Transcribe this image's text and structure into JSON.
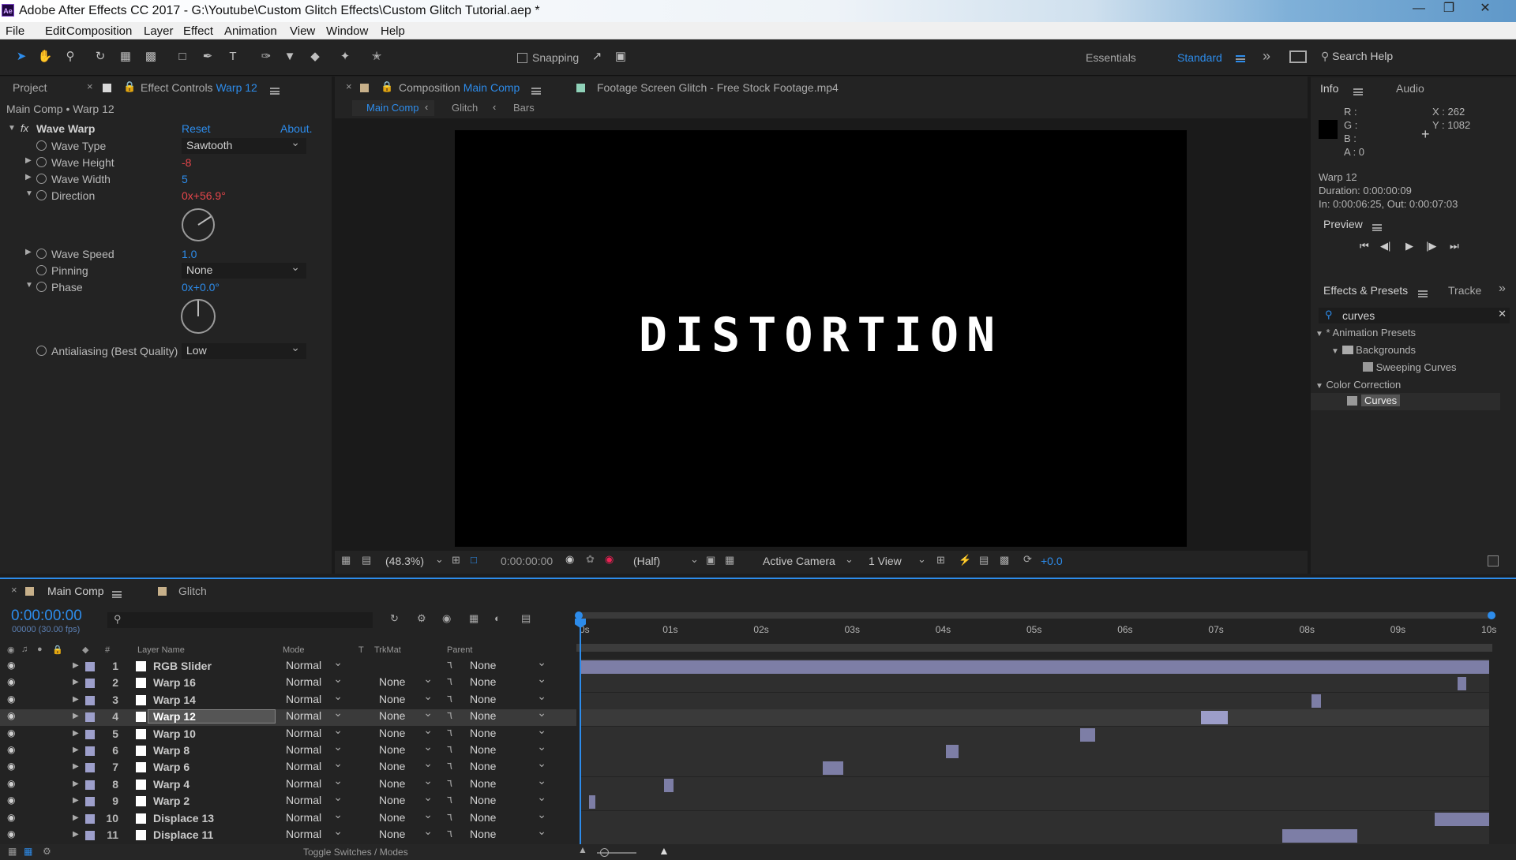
{
  "app": {
    "title": "Adobe After Effects CC 2017 - G:\\Youtube\\Custom Glitch Effects\\Custom Glitch Tutorial.aep *",
    "logo": "Ae"
  },
  "menu": [
    "File",
    "Edit",
    "Composition",
    "Layer",
    "Effect",
    "Animation",
    "View",
    "Window",
    "Help"
  ],
  "toolbar": {
    "snapping_label": "Snapping",
    "workspaces": [
      "Essentials",
      "Standard"
    ],
    "active_workspace": "Standard",
    "search_placeholder": "Search Help"
  },
  "left_panel": {
    "tab_project": "Project",
    "tab_effect_controls": "Effect Controls",
    "tab_effect_layer": "Warp 12",
    "breadcrumb": "Main Comp • Warp 12",
    "effect": {
      "fx": "fx",
      "name": "Wave Warp",
      "reset": "Reset",
      "about": "About."
    },
    "params": [
      {
        "name": "Wave Type",
        "value": "Sawtooth",
        "kind": "dropdown"
      },
      {
        "name": "Wave Height",
        "value": "-8",
        "kind": "red"
      },
      {
        "name": "Wave Width",
        "value": "5",
        "kind": "blue"
      },
      {
        "name": "Direction",
        "value_turns": "0x",
        "value_deg": "+56.9°",
        "kind": "angle"
      },
      {
        "name": "Wave Speed",
        "value": "1.0",
        "kind": "blue"
      },
      {
        "name": "Pinning",
        "value": "None",
        "kind": "dropdown"
      },
      {
        "name": "Phase",
        "value_turns": "0x",
        "value_deg": "+0.0°",
        "kind": "angle"
      },
      {
        "name": "Antialiasing (Best Quality)",
        "value": "Low",
        "kind": "dropdown"
      }
    ],
    "direction_angle_deg": 56.9,
    "phase_angle_deg": 0
  },
  "viewer": {
    "tab_label": "Composition",
    "tab_comp": "Main Comp",
    "footage_tab": "Footage  Screen Glitch - Free Stock Footage.mp4",
    "crumbs": [
      "Main Comp",
      "Glitch",
      "Bars"
    ],
    "canvas_text": "DISTORTION",
    "zoom": "(48.3%)",
    "timecode": "0:00:00:00",
    "resolution": "(Half)",
    "camera": "Active Camera",
    "views": "1 View",
    "exposure": "+0.0"
  },
  "info_panel": {
    "tab_info": "Info",
    "tab_audio": "Audio",
    "r": "R :",
    "g": "G :",
    "b": "B :",
    "a": "A : 0",
    "x": "X : 262",
    "y": "Y : 1082",
    "layer": "Warp 12",
    "duration": "Duration: 0:00:00:09",
    "inout": "In: 0:00:06:25, Out: 0:00:07:03"
  },
  "preview_panel": {
    "title": "Preview"
  },
  "effects_presets": {
    "title": "Effects & Presets",
    "other_tab": "Tracke",
    "search_value": "curves",
    "tree": [
      {
        "label": "* Animation Presets",
        "level": 0,
        "kind": "folder-open"
      },
      {
        "label": "Backgrounds",
        "level": 1,
        "kind": "folder"
      },
      {
        "label": "Sweeping Curves",
        "level": 2,
        "kind": "preset"
      },
      {
        "label": "Color Correction",
        "level": 0,
        "kind": "folder-open"
      },
      {
        "label": "Curves",
        "level": 1,
        "kind": "effect",
        "selected": true
      }
    ]
  },
  "timeline": {
    "tab_main": "Main Comp",
    "tab_glitch": "Glitch",
    "timecode": "0:00:00:00",
    "fps": "00000 (30.00 fps)",
    "columns": {
      "hash": "#",
      "layer_name": "Layer Name",
      "mode": "Mode",
      "t": "T",
      "trkmat": "TrkMat",
      "parent": "Parent"
    },
    "ruler": [
      "0s",
      "01s",
      "02s",
      "03s",
      "04s",
      "05s",
      "06s",
      "07s",
      "08s",
      "09s",
      "10s"
    ],
    "duration_s": 10,
    "footer": "Toggle Switches / Modes",
    "layers": [
      {
        "num": "1",
        "name": "RGB Slider",
        "mode": "Normal",
        "trkmat": "",
        "parent": "None",
        "in_s": 0.0,
        "out_s": 10.0
      },
      {
        "num": "2",
        "name": "Warp 16",
        "mode": "Normal",
        "trkmat": "None",
        "parent": "None",
        "in_s": 9.65,
        "out_s": 9.75
      },
      {
        "num": "3",
        "name": "Warp 14",
        "mode": "Normal",
        "trkmat": "None",
        "parent": "None",
        "in_s": 8.05,
        "out_s": 8.15
      },
      {
        "num": "4",
        "name": "Warp 12",
        "mode": "Normal",
        "trkmat": "None",
        "parent": "None",
        "in_s": 6.83,
        "out_s": 7.13,
        "selected": true
      },
      {
        "num": "5",
        "name": "Warp 10",
        "mode": "Normal",
        "trkmat": "None",
        "parent": "None",
        "in_s": 5.5,
        "out_s": 5.67
      },
      {
        "num": "6",
        "name": "Warp 8",
        "mode": "Normal",
        "trkmat": "None",
        "parent": "None",
        "in_s": 4.03,
        "out_s": 4.17
      },
      {
        "num": "7",
        "name": "Warp 6",
        "mode": "Normal",
        "trkmat": "None",
        "parent": "None",
        "in_s": 2.67,
        "out_s": 2.9
      },
      {
        "num": "8",
        "name": "Warp 4",
        "mode": "Normal",
        "trkmat": "None",
        "parent": "None",
        "in_s": 0.93,
        "out_s": 1.03
      },
      {
        "num": "9",
        "name": "Warp 2",
        "mode": "Normal",
        "trkmat": "None",
        "parent": "None",
        "in_s": 0.1,
        "out_s": 0.17
      },
      {
        "num": "10",
        "name": "Displace 13",
        "mode": "Normal",
        "trkmat": "None",
        "parent": "None",
        "in_s": 9.4,
        "out_s": 10.0
      },
      {
        "num": "11",
        "name": "Displace 11",
        "mode": "Normal",
        "trkmat": "None",
        "parent": "None",
        "in_s": 7.73,
        "out_s": 8.55
      }
    ]
  },
  "colors": {
    "accent": "#2d8ceb",
    "warning": "#e6464b",
    "label_lavender": "#9d9fcb",
    "layer_bar": "#7d7ea6"
  }
}
